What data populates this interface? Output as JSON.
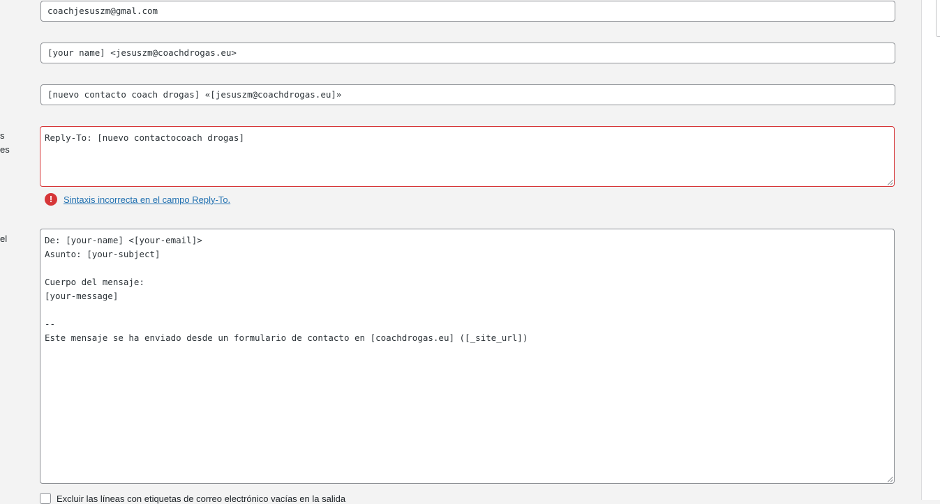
{
  "labels": {
    "additional_headers_fragment_1": "s",
    "additional_headers_fragment_2": "es",
    "message_body_fragment": "el"
  },
  "fields": {
    "to": "coachjesuszm@gmal.com",
    "from": "[your name] <jesuszm@coachdrogas.eu>",
    "subject": "[nuevo contacto coach drogas] «[jesuszm@coachdrogas.eu]»"
  },
  "additional_headers": {
    "value": "Reply-To: [nuevo contactocoach drogas]",
    "error": "Sintaxis incorrecta en el campo Reply-To."
  },
  "message_body": {
    "value": "De: [your-name] <[your-email]>\nAsunto: [your-subject]\n\nCuerpo del mensaje:\n[your-message]\n\n--\nEste mensaje se ha enviado desde un formulario de contacto en [coachdrogas.eu] ([_site_url])"
  },
  "exclude_blank": {
    "label": "Excluir las líneas con etiquetas de correo electrónico vacías en la salida",
    "checked": false
  },
  "colors": {
    "error": "#d63638",
    "link": "#2271b1",
    "border": "#8c8f94",
    "background": "#f3f3f3"
  }
}
